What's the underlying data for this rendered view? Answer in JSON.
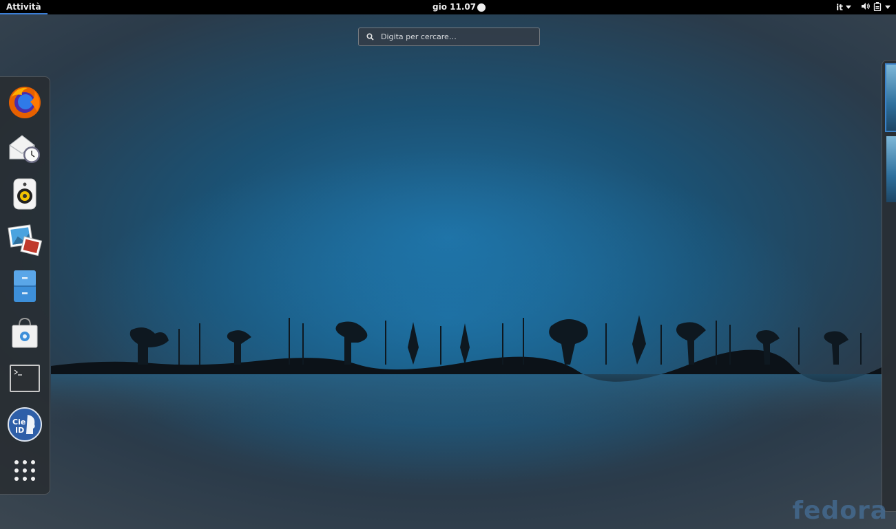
{
  "topbar": {
    "activities_label": "Attività",
    "clock": "gio 11.07",
    "keyboard_layout": "it",
    "tray_icons": [
      "volume-icon",
      "battery-icon",
      "chevron-down-icon"
    ]
  },
  "search": {
    "placeholder": "Digita per cercare…"
  },
  "dash": {
    "apps": [
      {
        "name": "firefox",
        "icon": "firefox-icon"
      },
      {
        "name": "evolution",
        "icon": "mail-clock-icon"
      },
      {
        "name": "rhythmbox",
        "icon": "speaker-icon"
      },
      {
        "name": "shotwell",
        "icon": "photos-icon"
      },
      {
        "name": "files",
        "icon": "file-cabinet-icon"
      },
      {
        "name": "software",
        "icon": "shopping-bag-icon"
      },
      {
        "name": "terminal",
        "icon": "terminal-icon"
      },
      {
        "name": "cie-id",
        "icon": "cie-id-icon",
        "label": "Cie ID"
      },
      {
        "name": "show-applications",
        "icon": "app-grid-icon"
      }
    ]
  },
  "workspaces": {
    "count": 2,
    "active": 1
  },
  "wallpaper": {
    "watermark": "fedora"
  },
  "colors": {
    "accent": "#3b82c8",
    "topbar": "#000000"
  }
}
